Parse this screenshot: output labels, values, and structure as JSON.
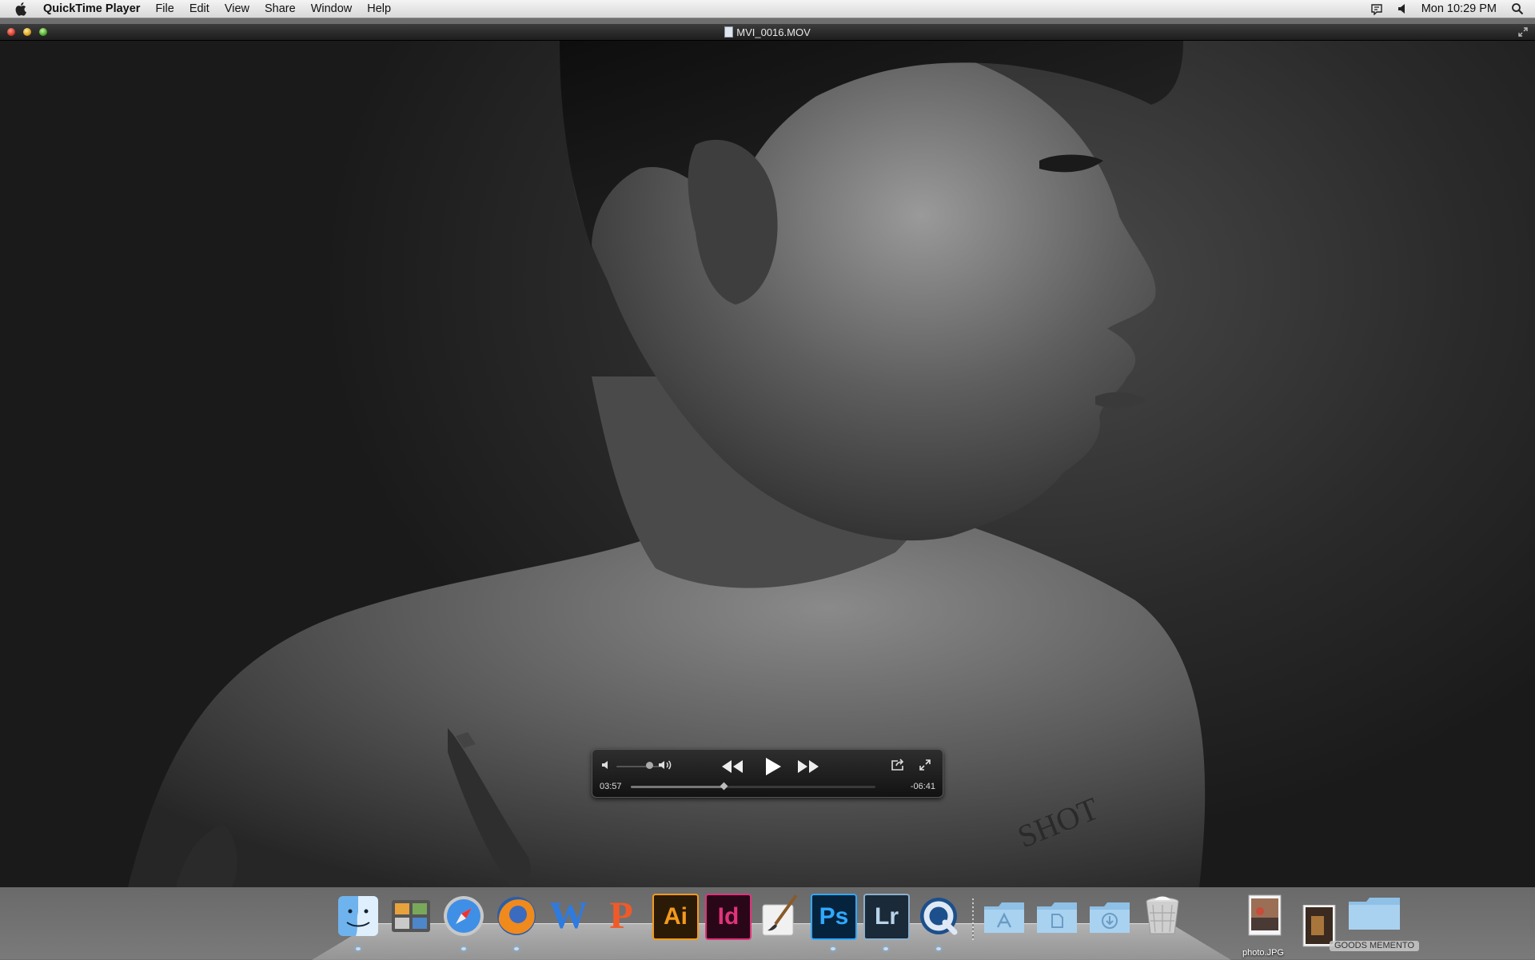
{
  "menubar": {
    "app_name": "QuickTime Player",
    "menus": [
      "File",
      "Edit",
      "View",
      "Share",
      "Window",
      "Help"
    ],
    "clock": "Mon 10:29 PM"
  },
  "window": {
    "title": "MVI_0016.MOV"
  },
  "player": {
    "elapsed": "03:57",
    "remaining": "-06:41",
    "progress": 0.38,
    "volume": 0.75
  },
  "dock": {
    "apps": [
      {
        "name": "finder-icon",
        "label": ""
      },
      {
        "name": "photo-browser-icon",
        "label": ""
      },
      {
        "name": "safari-icon",
        "label": ""
      },
      {
        "name": "firefox-icon",
        "label": ""
      },
      {
        "name": "word-icon",
        "label": "W"
      },
      {
        "name": "powerpoint-icon",
        "label": "P"
      },
      {
        "name": "illustrator-icon",
        "label": "Ai"
      },
      {
        "name": "indesign-icon",
        "label": "Id"
      },
      {
        "name": "brush-app-icon",
        "label": ""
      },
      {
        "name": "photoshop-icon",
        "label": "Ps"
      },
      {
        "name": "lightroom-icon",
        "label": "Lr"
      },
      {
        "name": "quicktime-icon",
        "label": ""
      }
    ],
    "stacks": [
      {
        "name": "applications-folder-icon"
      },
      {
        "name": "documents-folder-icon"
      },
      {
        "name": "downloads-folder-icon"
      },
      {
        "name": "trash-icon"
      }
    ],
    "photo_label": "photo.JPG",
    "folder_label": "GOODS MEMENTO"
  }
}
